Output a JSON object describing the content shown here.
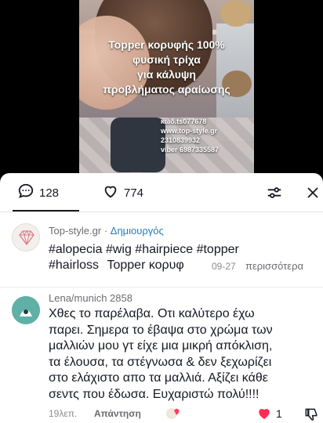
{
  "video": {
    "overlay_lines": [
      "Topper κορυφής 100%",
      "φυσική τρίχα",
      "για κάλυψη",
      "προβλήματος αραίωσης"
    ],
    "contact_lines": [
      "κωδ.ts077678",
      "www.top-style.gr",
      "2310839932",
      "viber 6987335587"
    ]
  },
  "tabs": {
    "comments_count": "128",
    "likes_count": "774"
  },
  "caption": {
    "author": "Top-style.gr",
    "separator": " · ",
    "author_role": "Δημιουργός",
    "hashtags_line1": "#alopecia #wig #hairpiece #topper",
    "hashtags_line2": "#hairloss",
    "text_trunc": "Topper κορυφ",
    "date": "09-27",
    "more": "περισσότερα"
  },
  "comment": {
    "user": "Lena/munich 2858",
    "lines": [
      "Χθες το παρέλαβα. Οτι καλύτερο έχω",
      "παρει. Σημερα το έβαψα στο χρώμα των",
      "μαλλιών μου γτ είχε μια μικρή απόκλιση,",
      "τα έλουσα, τα στέγνωσα & δεν ξεχωρίζει",
      "στο ελάχιστο απο τα μαλλιά. Αξίζει κάθε",
      "σεντς που έδωσα. Ευχαριστώ πολύ!!!!"
    ],
    "time": "19λεπ.",
    "reply": "Απάντηση",
    "like_count": "1",
    "like_color": "#fe2c55"
  },
  "icons": {
    "comment": "comment-bubble-icon",
    "like": "heart-outline-icon",
    "filter": "sliders-icon",
    "close": "close-icon"
  }
}
